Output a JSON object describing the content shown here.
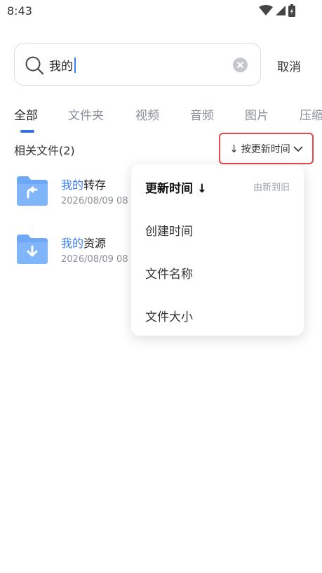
{
  "status_bar": {
    "time": "8:43"
  },
  "search": {
    "query_prefix": "我的"
  },
  "cancel_label": "取消",
  "tabs": [
    {
      "label": "全部",
      "active": true
    },
    {
      "label": "文件夹",
      "active": false
    },
    {
      "label": "视频",
      "active": false
    },
    {
      "label": "音频",
      "active": false
    },
    {
      "label": "图片",
      "active": false
    },
    {
      "label": "压缩",
      "active": false
    }
  ],
  "results": {
    "label": "相关文件(2)",
    "sort_label": "按更新时间",
    "files": [
      {
        "name_highlight": "我的",
        "name_rest": "转存",
        "date": "2026/08/09 08",
        "icon": "folder-share-icon"
      },
      {
        "name_highlight": "我的",
        "name_rest": "资源",
        "date": "2026/08/09 08",
        "icon": "folder-download-icon"
      }
    ]
  },
  "sort_menu": {
    "items": [
      {
        "label": "更新时间 ↓",
        "hint": "由新到旧",
        "active": true
      },
      {
        "label": "创建时间",
        "active": false
      },
      {
        "label": "文件名称",
        "active": false
      },
      {
        "label": "文件大小",
        "active": false
      }
    ]
  },
  "colors": {
    "accent": "#3c7cf0",
    "highlight_border": "#e24c4c",
    "folder": "#6fa8f7"
  }
}
